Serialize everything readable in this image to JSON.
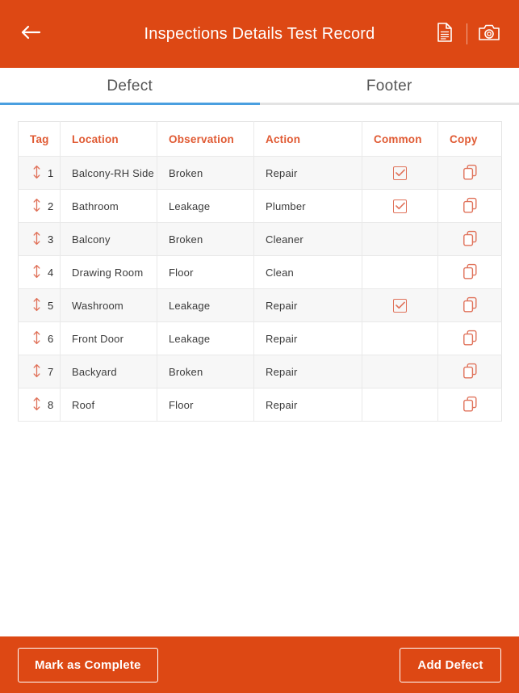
{
  "theme": {
    "primary": "#dd4814",
    "accent_blue": "#4a9fe0",
    "header_text": "#e05a33",
    "icon_coral": "#e0725a"
  },
  "appbar": {
    "back_icon": "arrow-left-icon",
    "title": "Inspections Details Test Record",
    "actions": [
      {
        "icon": "document-icon",
        "label": "Document"
      },
      {
        "icon": "camera-icon",
        "label": "Camera"
      }
    ]
  },
  "tabs": [
    {
      "label": "Defect",
      "active": true
    },
    {
      "label": "Footer",
      "active": false
    }
  ],
  "table": {
    "columns": [
      "Tag",
      "Location",
      "Observation",
      "Action",
      "Common",
      "Copy"
    ],
    "rows": [
      {
        "tag": "1",
        "location": "Balcony-RH Side",
        "observation": "Broken",
        "action": "Repair",
        "common": true,
        "copy_icon": "copy-icon"
      },
      {
        "tag": "2",
        "location": "Bathroom",
        "observation": "Leakage",
        "action": "Plumber",
        "common": true,
        "copy_icon": "copy-icon"
      },
      {
        "tag": "3",
        "location": "Balcony",
        "observation": "Broken",
        "action": "Cleaner",
        "common": false,
        "copy_icon": "copy-icon"
      },
      {
        "tag": "4",
        "location": "Drawing Room",
        "observation": "Floor",
        "action": "Clean",
        "common": false,
        "copy_icon": "copy-icon"
      },
      {
        "tag": "5",
        "location": "Washroom",
        "observation": "Leakage",
        "action": "Repair",
        "common": true,
        "copy_icon": "copy-icon"
      },
      {
        "tag": "6",
        "location": "Front Door",
        "observation": "Leakage",
        "action": "Repair",
        "common": false,
        "copy_icon": "copy-icon"
      },
      {
        "tag": "7",
        "location": "Backyard",
        "observation": "Broken",
        "action": "Repair",
        "common": false,
        "copy_icon": "copy-icon"
      },
      {
        "tag": "8",
        "location": "Roof",
        "observation": "Floor",
        "action": "Repair",
        "common": false,
        "copy_icon": "copy-icon"
      }
    ]
  },
  "bottombar": {
    "mark_complete_label": "Mark as Complete",
    "add_defect_label": "Add Defect"
  }
}
